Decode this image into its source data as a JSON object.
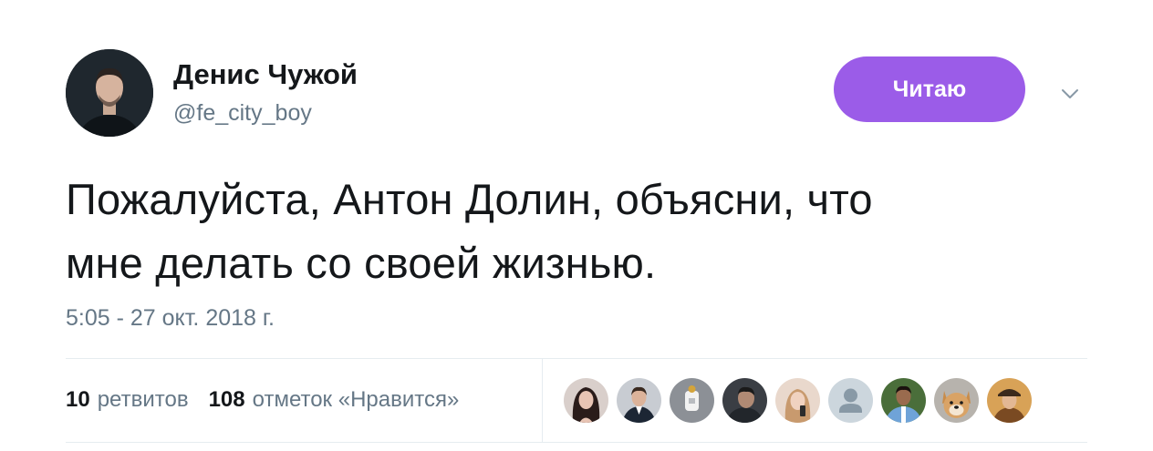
{
  "author": {
    "display_name": "Денис Чужой",
    "handle": "@fe_city_boy"
  },
  "follow_button": {
    "label": "Читаю",
    "color": "#9b5ce8"
  },
  "tweet": {
    "text_line1": "Пожалуйста, Антон Долин, объясни, что",
    "text_line2": "мне делать со своей жизнью.",
    "timestamp": "5:05 - 27 окт. 2018 г."
  },
  "stats": {
    "retweets_count": "10",
    "retweets_label": "ретвитов",
    "likes_count": "108",
    "likes_label": "отметок «Нравится»"
  },
  "likers": [
    {
      "icon": "avatar-woman-dark-hair"
    },
    {
      "icon": "avatar-man-suit"
    },
    {
      "icon": "avatar-gray-illustration"
    },
    {
      "icon": "avatar-man-dark"
    },
    {
      "icon": "avatar-woman-light"
    },
    {
      "icon": "avatar-default-silhouette"
    },
    {
      "icon": "avatar-football-player"
    },
    {
      "icon": "avatar-dog"
    },
    {
      "icon": "avatar-man-hat"
    }
  ],
  "colors": {
    "text_primary": "#14171a",
    "text_secondary": "#657786",
    "divider": "#e6ecf0"
  }
}
